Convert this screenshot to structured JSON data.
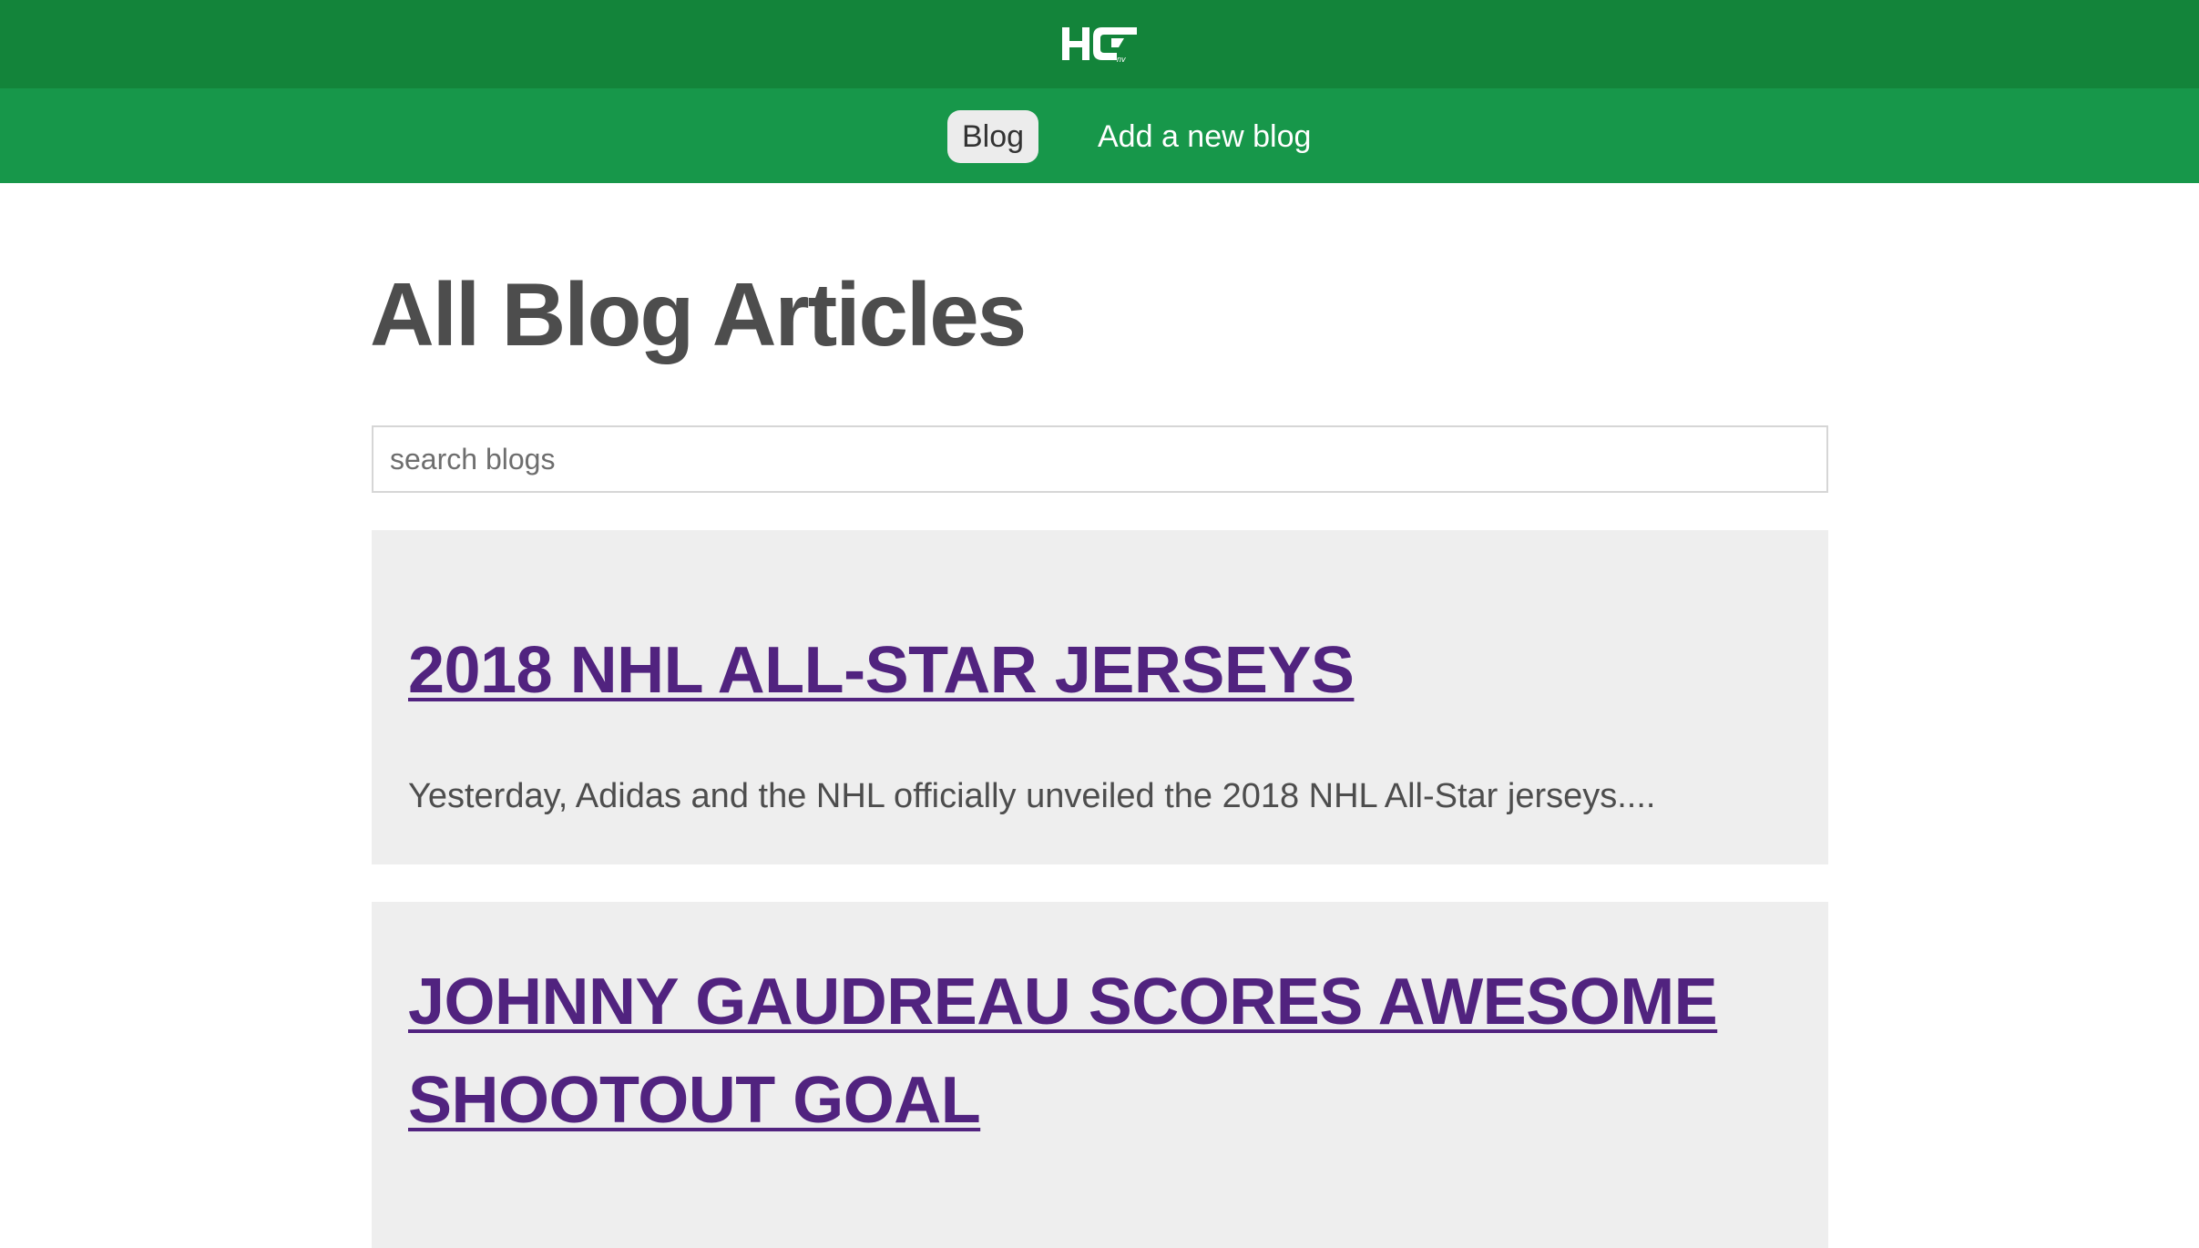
{
  "header": {
    "logo_icon": "hc-logo-icon",
    "colors": {
      "top_bar": "#13843a",
      "nav_bar": "#17974a",
      "active_tab_bg": "#ececec",
      "link_title": "#51237f",
      "card_bg": "#eeeeee"
    }
  },
  "nav": {
    "items": [
      {
        "label": "Blog",
        "active": true
      },
      {
        "label": "Add a new blog",
        "active": false
      }
    ]
  },
  "main": {
    "title": "All Blog Articles",
    "search": {
      "placeholder": "search blogs",
      "value": ""
    },
    "articles": [
      {
        "title": "2018 NHL ALL-STAR JERSEYS",
        "excerpt": "Yesterday, Adidas and the NHL officially unveiled the 2018 NHL All-Star jerseys...."
      },
      {
        "title": "JOHNNY GAUDREAU SCORES AWESOME SHOOTOUT GOAL",
        "excerpt": ""
      }
    ]
  }
}
